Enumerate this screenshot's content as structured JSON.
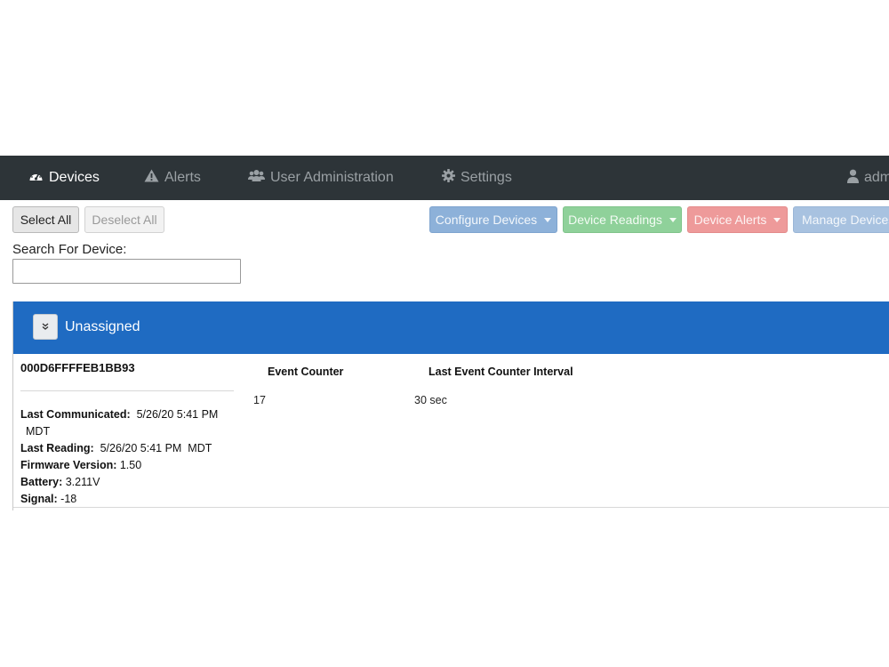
{
  "nav": {
    "devices": "Devices",
    "alerts": "Alerts",
    "user_administration": "User Administration",
    "settings": "Settings",
    "user": "adm"
  },
  "toolbar": {
    "select_all": "Select All",
    "deselect_all": "Deselect All",
    "configure_devices": "Configure Devices",
    "device_readings": "Device Readings",
    "device_alerts": "Device Alerts",
    "manage_devices": "Manage Devices"
  },
  "search": {
    "label": "Search For Device:",
    "value": "",
    "placeholder": ""
  },
  "group": {
    "title": "Unassigned",
    "device": {
      "id": "000D6FFFFEB1BB93",
      "last_communicated_label": "Last Communicated:",
      "last_communicated_value": "5/26/20 5:41 PM",
      "last_communicated_tz": "MDT",
      "last_reading_label": "Last Reading:",
      "last_reading_value": "5/26/20 5:41 PM  MDT",
      "firmware_label": "Firmware Version:",
      "firmware_value": "1.50",
      "battery_label": "Battery:",
      "battery_value": "3.211V",
      "signal_label": "Signal:",
      "signal_value": "-18"
    },
    "columns": [
      {
        "header": "Event Counter",
        "value": "17"
      },
      {
        "header": "Last Event Counter Interval",
        "value": "30 sec"
      }
    ]
  },
  "colors": {
    "navbar": "#2d3438",
    "group_header": "#1f6bc2",
    "configure": "#8db1d9",
    "readings": "#8fd19a",
    "alerts": "#ee9a9a",
    "manage": "#a8c2e0"
  },
  "icons": {
    "devices": "dashboard-icon",
    "alerts": "warning-icon",
    "user_administration": "users-icon",
    "settings": "gear-icon",
    "user": "user-icon",
    "collapse": "chevron-double-down-icon"
  }
}
